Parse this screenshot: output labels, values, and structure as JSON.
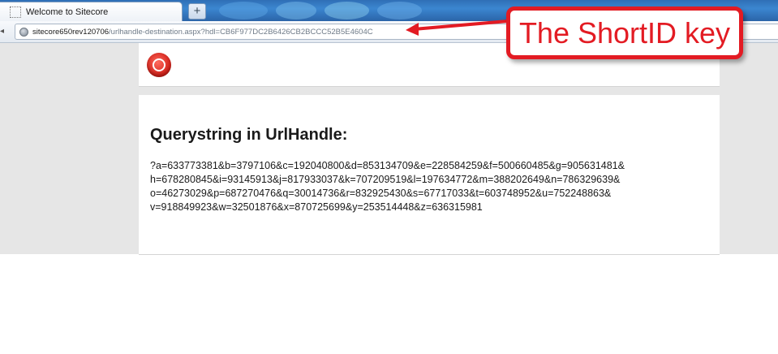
{
  "browser": {
    "tab_title": "Welcome to Sitecore",
    "new_tab_label": "+",
    "url_host": "sitecore650rev120706",
    "url_path": "/urlhandle-destination.aspx?hdl=CB6F977DC2B6426CB2BCCC52B5E4604C"
  },
  "page": {
    "heading": "Querystring in UrlHandle:",
    "querystring_lines": [
      "?a=633773381&b=3797106&c=192040800&d=853134709&e=228584259&f=500660485&g=905631481&",
      "h=678280845&i=93145913&j=817933037&k=707209519&l=197634772&m=388202649&n=786329639&",
      "o=46273029&p=687270476&q=30014736&r=832925430&s=67717033&t=603748952&u=752248863&",
      "v=918849923&w=32501876&x=870725699&y=253514448&z=636315981"
    ]
  },
  "annotation": {
    "label": "The ShortID key",
    "color": "#e31b23"
  },
  "icons": {
    "favicon": "page-placeholder-icon",
    "site_icon": "globe-icon",
    "logo": "sitecore-logo-icon"
  }
}
